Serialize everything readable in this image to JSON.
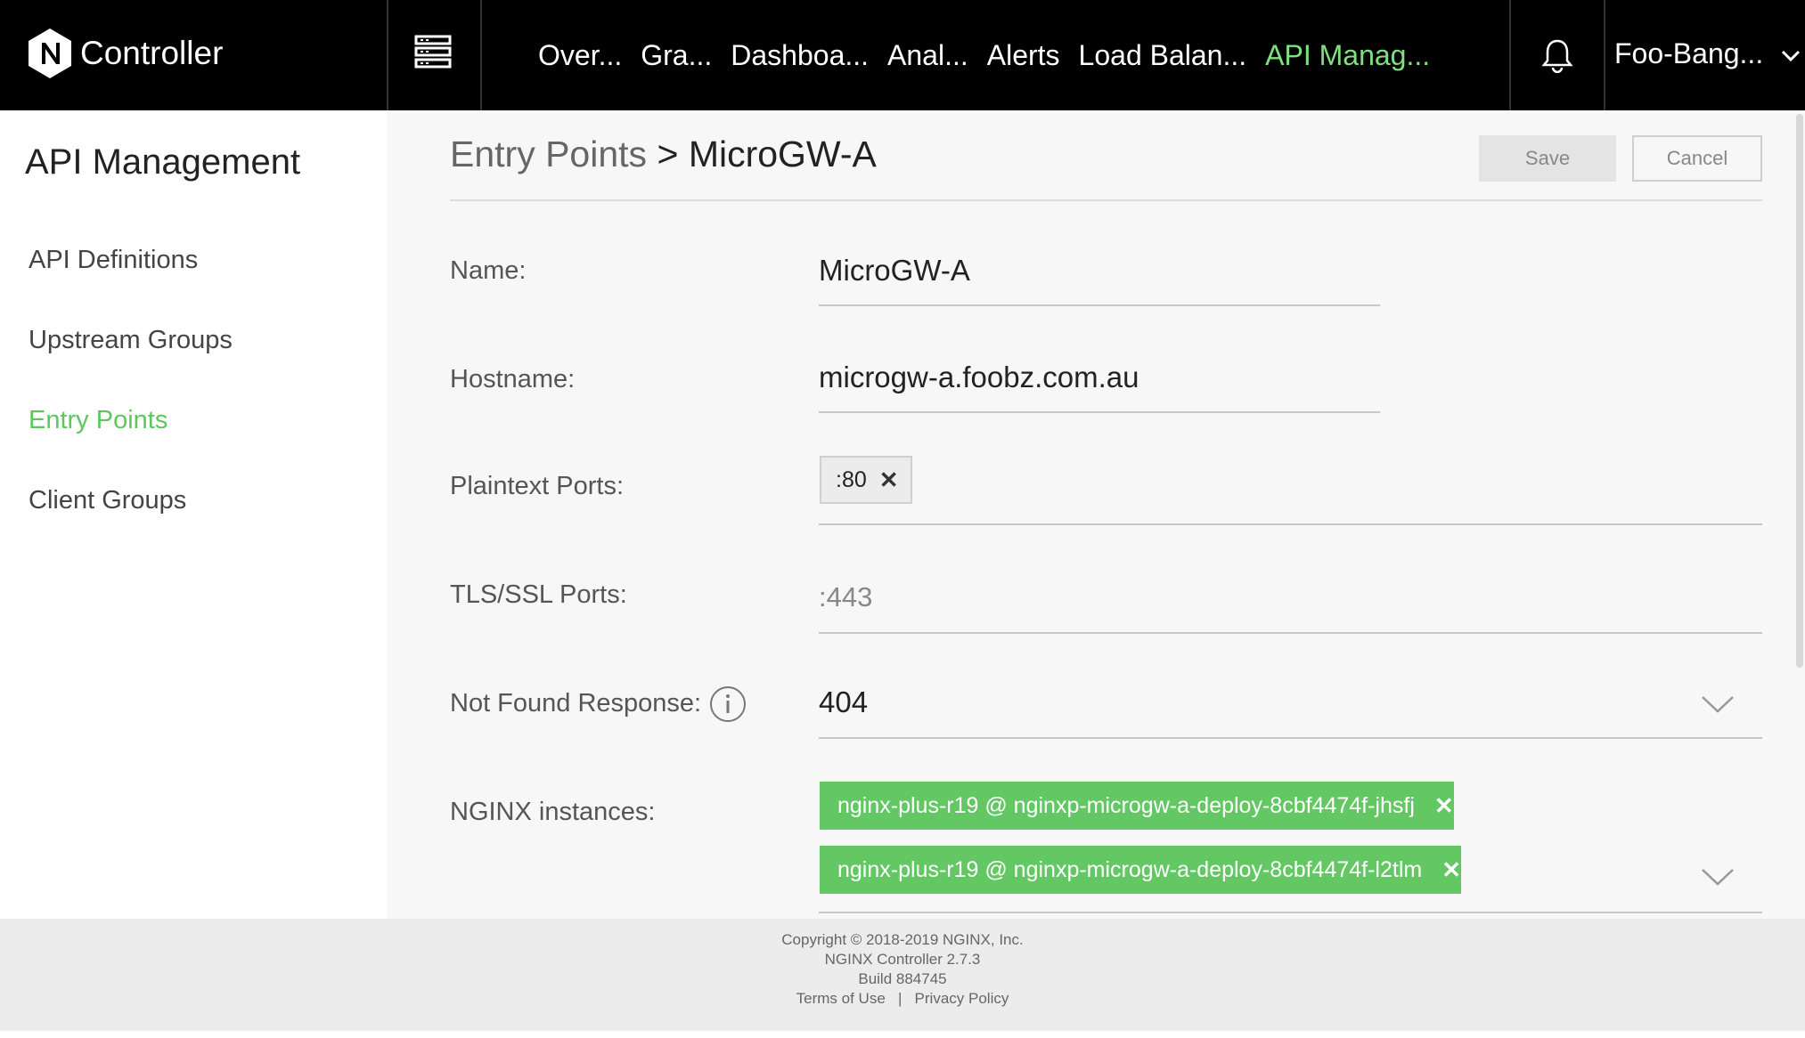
{
  "header": {
    "brand": "Controller",
    "nav": [
      "Over...",
      "Gra...",
      "Dashboa...",
      "Anal...",
      "Alerts",
      "Load Balan...",
      "API Manag..."
    ],
    "account": "Foo-Bang...",
    "active_color": "#7ee07e"
  },
  "sidebar": {
    "title": "API Management",
    "items": [
      {
        "label": "API Definitions"
      },
      {
        "label": "Upstream Groups"
      },
      {
        "label": "Entry Points",
        "active": true
      },
      {
        "label": "Client Groups"
      }
    ]
  },
  "main": {
    "breadcrumb": {
      "parent": "Entry Points",
      "separator": ">",
      "current": "MicroGW-A"
    },
    "save_label": "Save",
    "cancel_label": "Cancel",
    "fields": {
      "name": {
        "label": "Name:",
        "value": "MicroGW-A"
      },
      "hostname": {
        "label": "Hostname:",
        "value": "microgw-a.foobz.com.au"
      },
      "plaintext_ports": {
        "label": "Plaintext Ports:",
        "chips": [
          ":80"
        ]
      },
      "tls_ports": {
        "label": "TLS/SSL Ports:",
        "placeholder": ":443"
      },
      "not_found": {
        "label": "Not Found Response:",
        "value": "404"
      },
      "nginx_instances": {
        "label": "NGINX instances:",
        "chips": [
          "nginx-plus-r19 @ nginxp-microgw-a-deploy-8cbf4474f-jhsfj",
          "nginx-plus-r19 @ nginxp-microgw-a-deploy-8cbf4474f-l2tlm"
        ]
      }
    },
    "chip_remove": "✕",
    "accent_color": "#63c764"
  },
  "footer": {
    "copyright": "Copyright © 2018-2019 NGINX, Inc.",
    "version": "NGINX Controller 2.7.3",
    "build": "Build 884745",
    "terms": "Terms of Use",
    "divider": "|",
    "privacy": "Privacy Policy"
  }
}
